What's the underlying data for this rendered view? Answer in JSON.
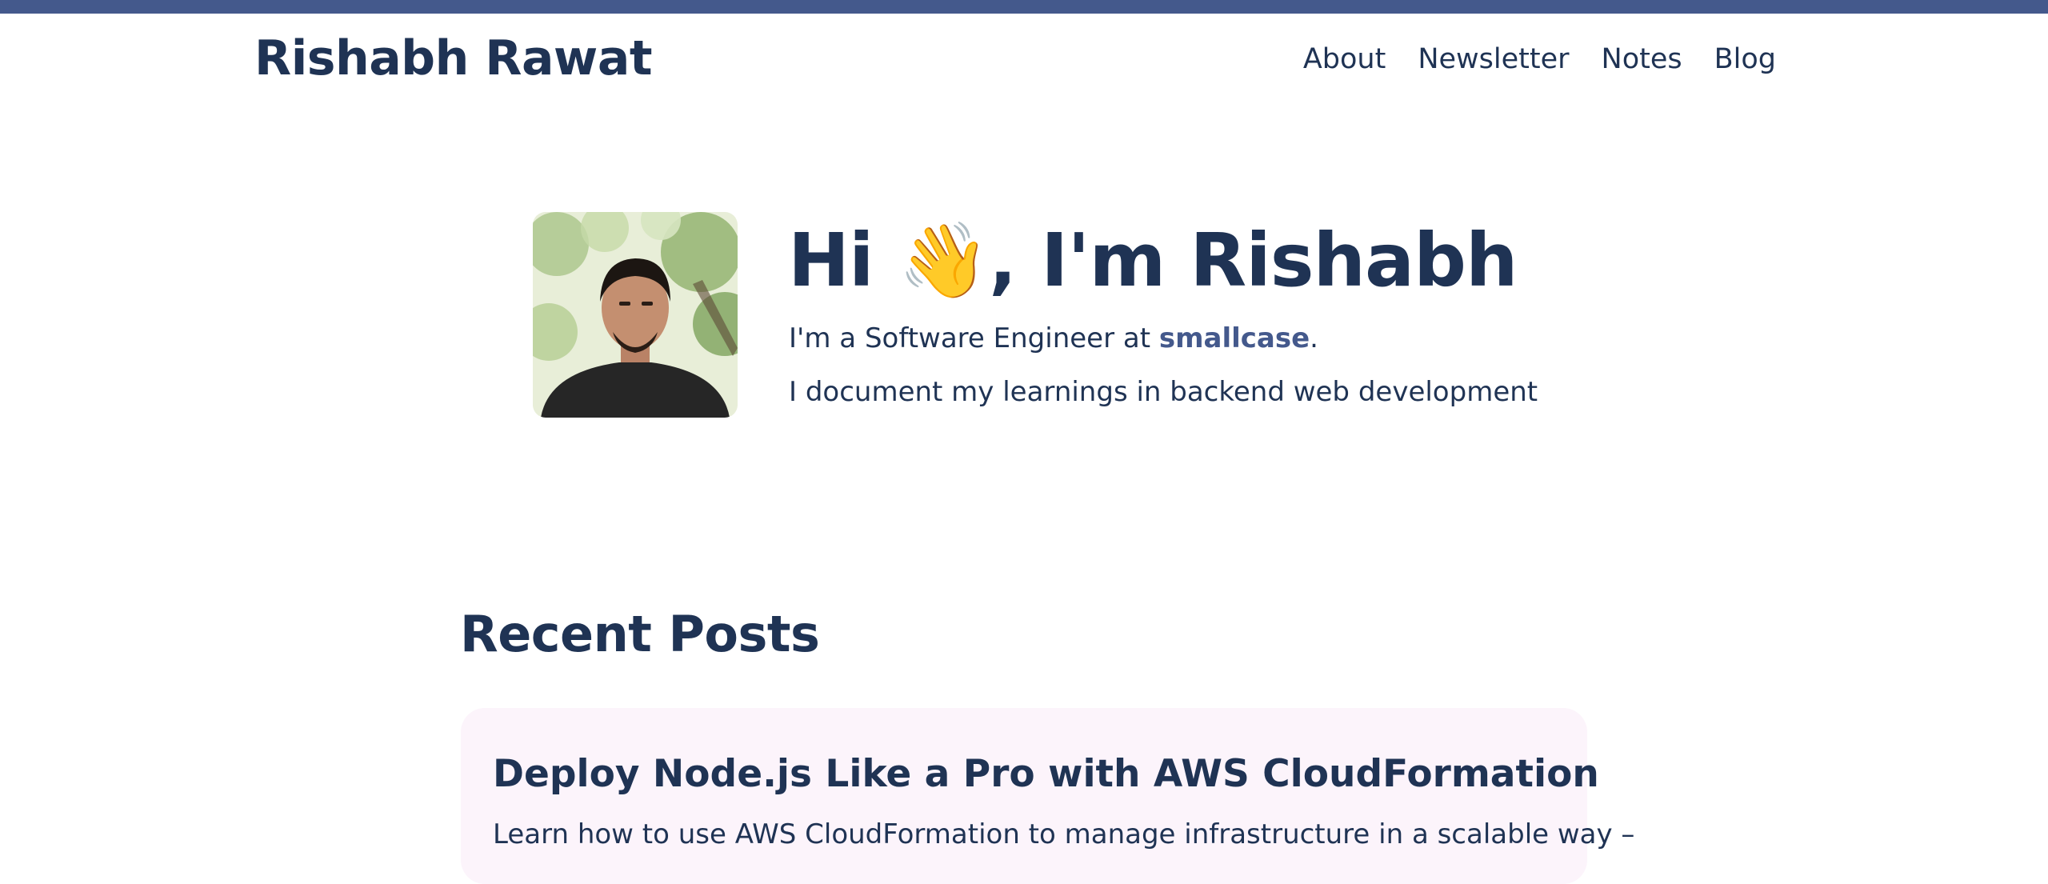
{
  "header": {
    "site_title": "Rishabh Rawat",
    "nav": [
      {
        "label": "About"
      },
      {
        "label": "Newsletter"
      },
      {
        "label": "Notes"
      },
      {
        "label": "Blog"
      }
    ]
  },
  "hero": {
    "title": "Hi 👋, I'm Rishabh",
    "line1_prefix": "I'm a Software Engineer at ",
    "line1_link": "smallcase",
    "line1_suffix": ".",
    "line2": "I document my learnings in backend web development"
  },
  "recent_posts": {
    "heading": "Recent Posts",
    "posts": [
      {
        "title": "Deploy Node.js Like a Pro with AWS CloudFormation",
        "excerpt": "Learn how to use AWS CloudFormation to manage infrastructure in a scalable way –"
      }
    ]
  },
  "colors": {
    "brand": "#44598c",
    "text": "#1f3354",
    "card_bg": "#fcf4fb"
  }
}
